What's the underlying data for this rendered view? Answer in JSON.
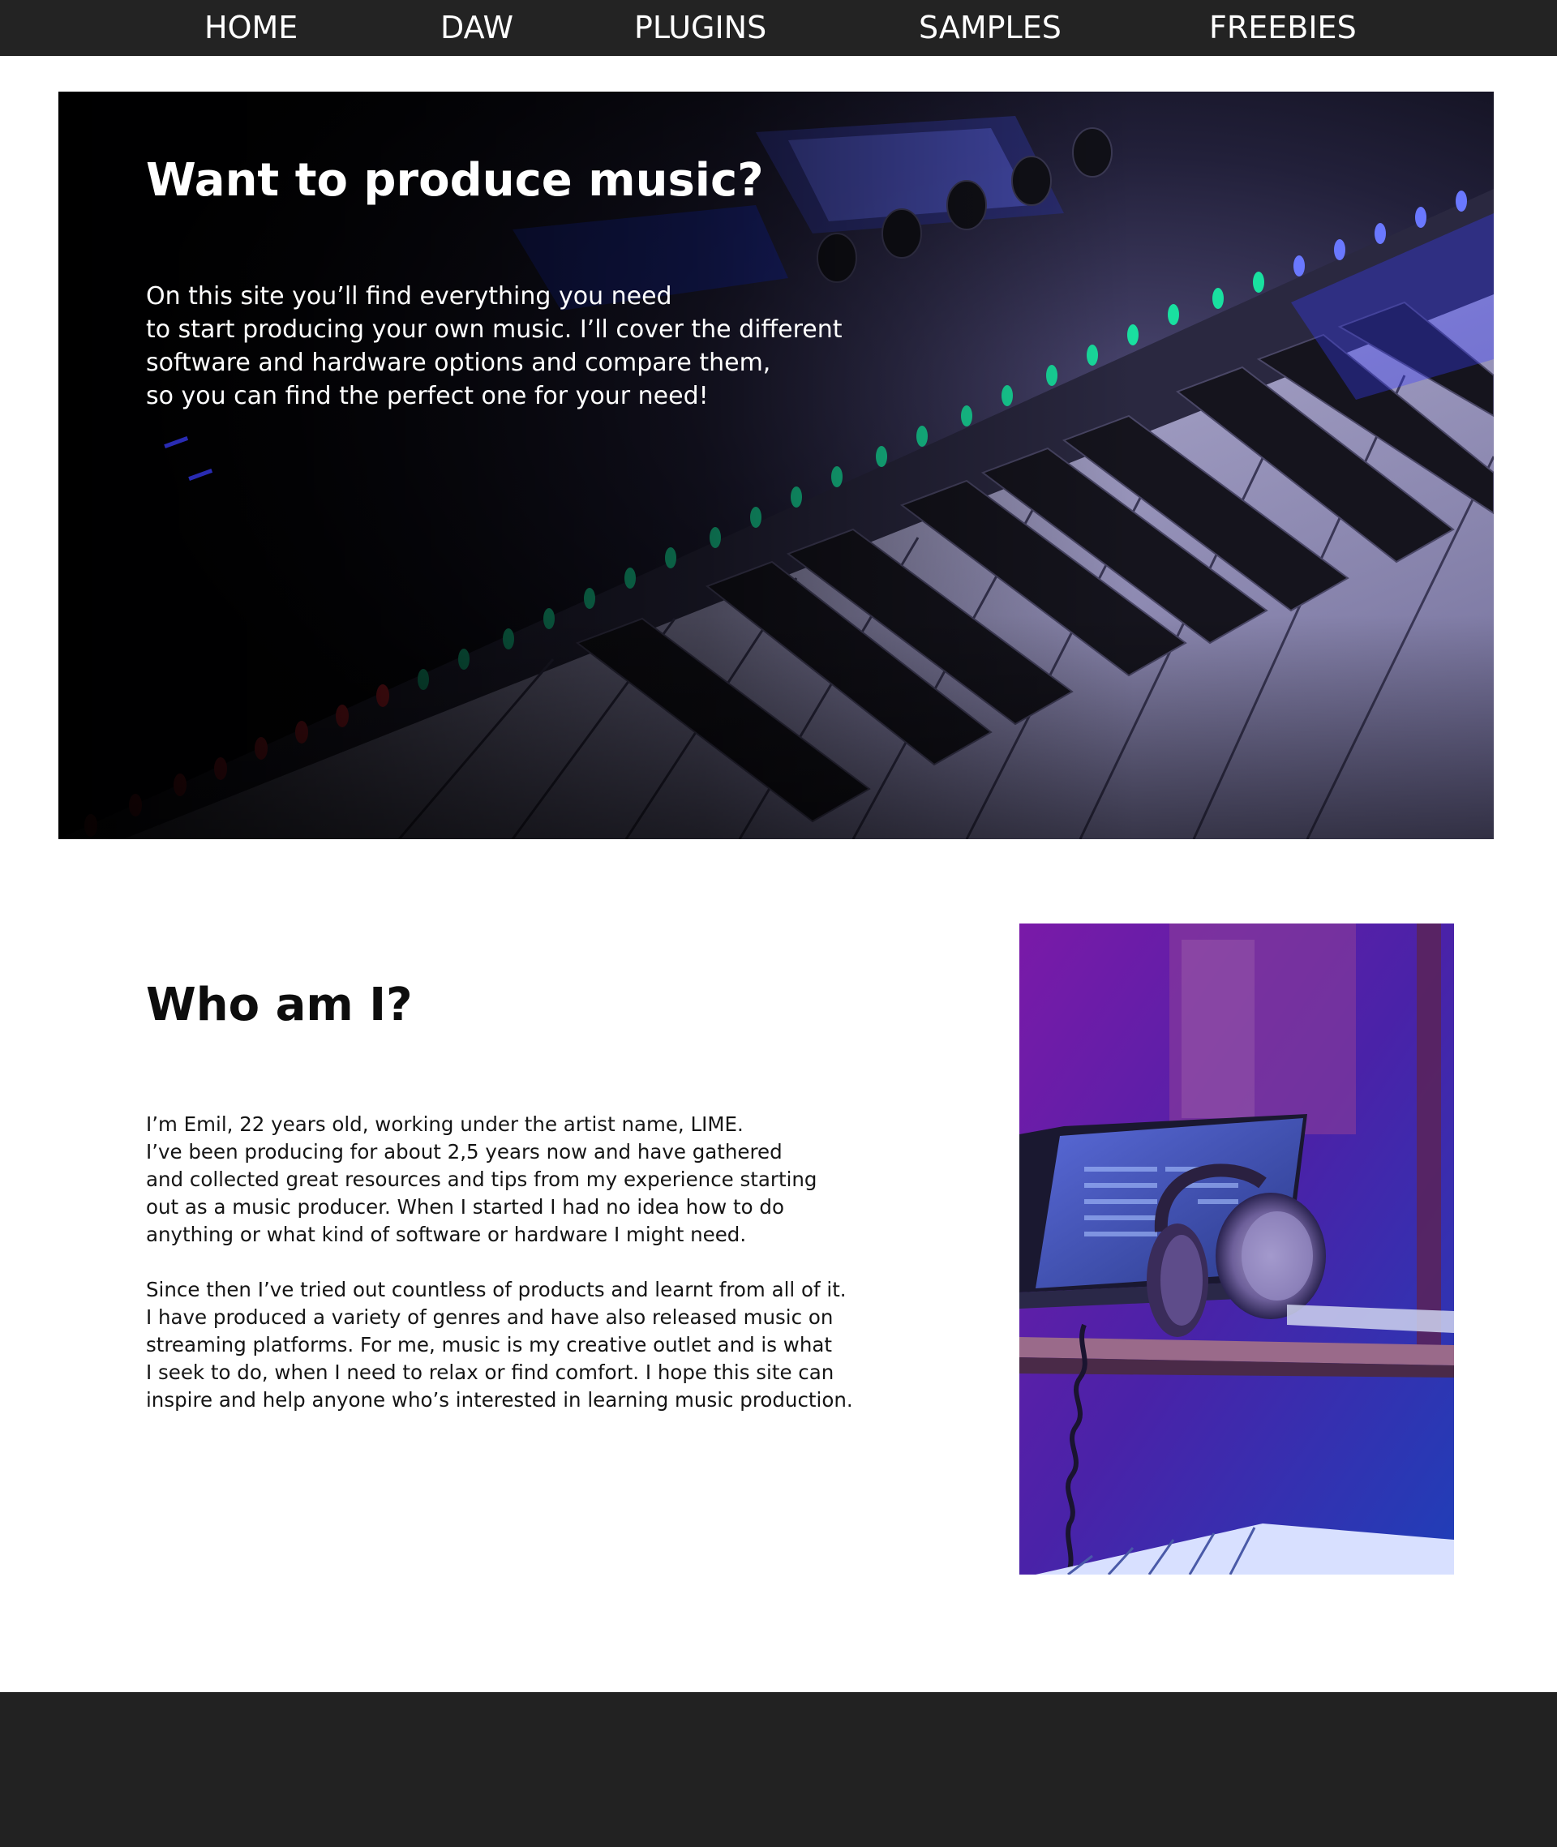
{
  "nav": {
    "items": [
      {
        "label": "HOME"
      },
      {
        "label": "DAW"
      },
      {
        "label": "PLUGINS"
      },
      {
        "label": "SAMPLES"
      },
      {
        "label": "FREEBIES"
      }
    ]
  },
  "hero": {
    "title": "Want to produce music?",
    "lines": [
      "On this site you’ll find everything you need",
      "to start producing your own music. I’ll cover the different",
      "software and hardware options and compare them,",
      "so you can find the perfect one for your need!"
    ],
    "image": "keyboard-synth-photo"
  },
  "about": {
    "title": "Who am I?",
    "paragraph1": [
      "I’m Emil, 22 years old, working under the artist name, LIME.",
      "I’ve been producing for about 2,5 years now and have gathered",
      "and collected great resources and tips from my experience starting",
      "out as a music producer. When I started I had no idea how to do",
      "anything or what kind of software or hardware I might need."
    ],
    "paragraph2": [
      "Since then I’ve tried out countless of products and learnt from all of it.",
      "I have produced a variety of genres and have also released music on",
      "streaming platforms. For me, music is my creative outlet and is what",
      "I seek to do, when I need to relax or find comfort. I hope this site can",
      "inspire and help anyone who’s interested in learning music production."
    ],
    "image": "studio-headphones-laptop-photo"
  },
  "colors": {
    "nav_bg": "#232323",
    "footer_bg": "#222222",
    "text_light": "#ffffff",
    "text_dark": "#111111",
    "accent_blue": "#3a3dff",
    "accent_green": "#19e0a0",
    "accent_red": "#ff2a3a",
    "accent_purple": "#8a2bd0"
  }
}
